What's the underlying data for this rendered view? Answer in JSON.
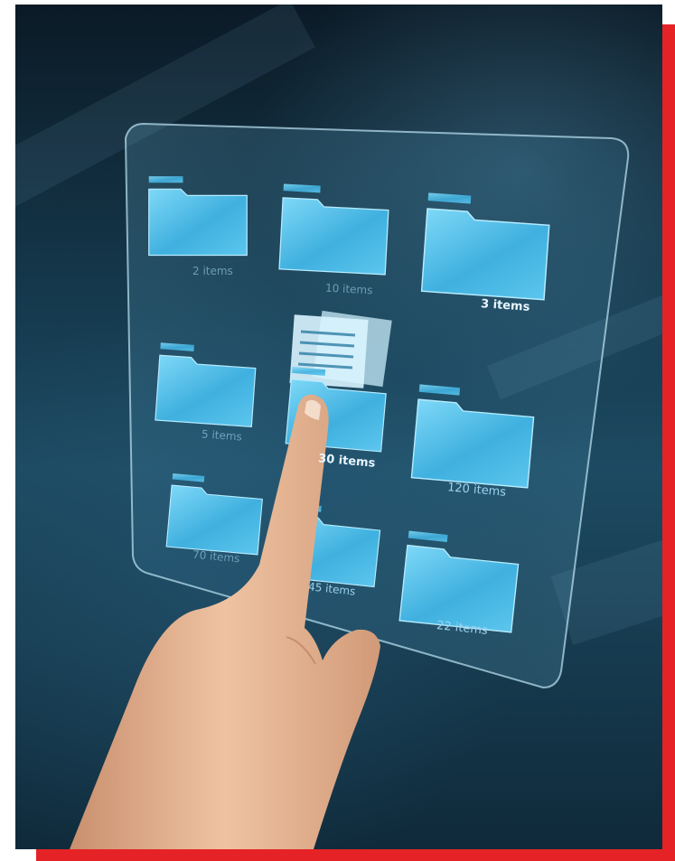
{
  "folders": [
    {
      "label": "2 items"
    },
    {
      "label": "10 items"
    },
    {
      "label": "3 items"
    },
    {
      "label": "5 items"
    },
    {
      "label": "30 items"
    },
    {
      "label": "120 items"
    },
    {
      "label": "70 items"
    },
    {
      "label": "45 items"
    },
    {
      "label": "22 items"
    }
  ],
  "colors": {
    "frame_accent": "#e52326",
    "folder_fill": "#5cc6ee",
    "background": "#15394d"
  },
  "icons": [
    "folder-icon",
    "document-icon",
    "hand-pointing"
  ]
}
